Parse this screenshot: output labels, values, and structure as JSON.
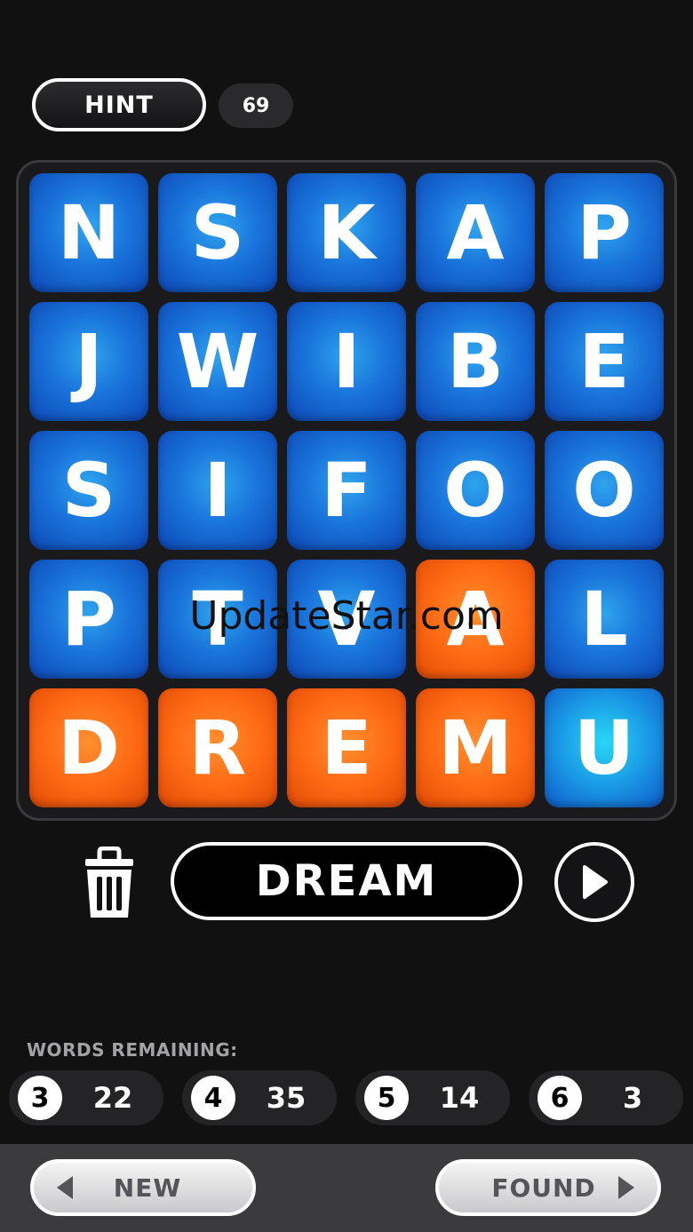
{
  "hint": {
    "label": "HINT",
    "count": "69"
  },
  "board": {
    "rows": [
      [
        "N",
        "S",
        "K",
        "A",
        "P"
      ],
      [
        "J",
        "W",
        "I",
        "B",
        "E"
      ],
      [
        "S",
        "I",
        "F",
        "O",
        "O"
      ],
      [
        "P",
        "T",
        "V",
        "A",
        "L"
      ],
      [
        "D",
        "R",
        "E",
        "M",
        "U"
      ]
    ],
    "selected": [
      [
        3,
        3
      ],
      [
        4,
        0
      ],
      [
        4,
        1
      ],
      [
        4,
        2
      ],
      [
        4,
        3
      ]
    ],
    "highlight": [
      [
        4,
        4
      ]
    ]
  },
  "current_word": "DREAM",
  "words_remaining": {
    "label": "WORDS REMAINING:",
    "groups": [
      {
        "length": "3",
        "count": "22"
      },
      {
        "length": "4",
        "count": "35"
      },
      {
        "length": "5",
        "count": "14"
      },
      {
        "length": "6",
        "count": "3"
      }
    ]
  },
  "nav": {
    "new_label": "NEW",
    "found_label": "FOUND"
  },
  "watermark": "UpdateStar.com",
  "colors": {
    "tile_blue": "#1a74db",
    "tile_orange": "#ff6a14",
    "tile_cyan": "#29d7f4",
    "background": "#111111"
  }
}
